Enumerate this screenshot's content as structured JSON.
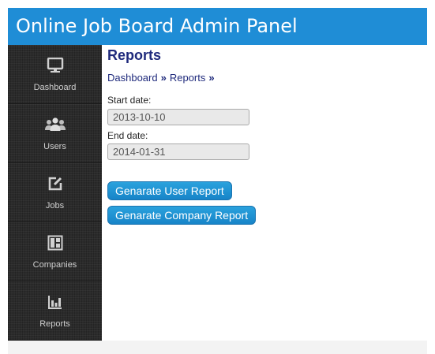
{
  "app": {
    "title": "Online Job Board Admin Panel"
  },
  "sidebar": {
    "items": [
      {
        "label": "Dashboard",
        "icon": "monitor-icon"
      },
      {
        "label": "Users",
        "icon": "users-icon"
      },
      {
        "label": "Jobs",
        "icon": "edit-icon"
      },
      {
        "label": "Companies",
        "icon": "layout-icon"
      },
      {
        "label": "Reports",
        "icon": "bar-chart-icon"
      }
    ]
  },
  "page": {
    "title": "Reports",
    "breadcrumb": {
      "items": [
        "Dashboard",
        "Reports"
      ],
      "separator": "»"
    }
  },
  "form": {
    "start_date": {
      "label": "Start date:",
      "value": "2013-10-10"
    },
    "end_date": {
      "label": "End date:",
      "value": "2014-01-31"
    }
  },
  "actions": {
    "user_report": "Genarate User Report",
    "company_report": "Genarate Company Report"
  },
  "colors": {
    "header": "#1f8dd6",
    "sidebar": "#2b2b2b",
    "button": "#1784c8",
    "title_text": "#1f2a7c"
  }
}
